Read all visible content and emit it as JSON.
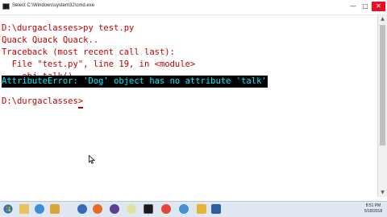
{
  "window": {
    "title": "Select C:\\Windows\\system32\\cmd.exe",
    "icon": "cmd-icon"
  },
  "console": {
    "lines": [
      "D:\\durgaclasses>py test.py",
      "Quack Quack Quack..",
      "Traceback (most recent call last):",
      "  File \"test.py\", line 19, in <module>",
      "    obj.talk()",
      "AttributeError: 'Dog' object has no attribute 'talk'",
      "",
      "D:\\durgaclasses>"
    ],
    "highlighted_line": 5,
    "colors": {
      "text": "#c00000",
      "highlight_bg": "#000000",
      "highlight_text": "#00f0ff",
      "background": "#ffffff"
    }
  },
  "taskbar": {
    "buttons": [
      "start-button",
      "file-explorer-icon",
      "media-player-icon",
      "folder-icon",
      "firefox-icon",
      "chrome-icon",
      "eclipse-icon",
      "command-prompt-icon",
      "notepad-icon",
      "chrome-icon",
      "settings-icon",
      "python-icon",
      "app-icon"
    ],
    "clock": {
      "time": "8:51 PM",
      "date": "5/18/2018"
    }
  }
}
